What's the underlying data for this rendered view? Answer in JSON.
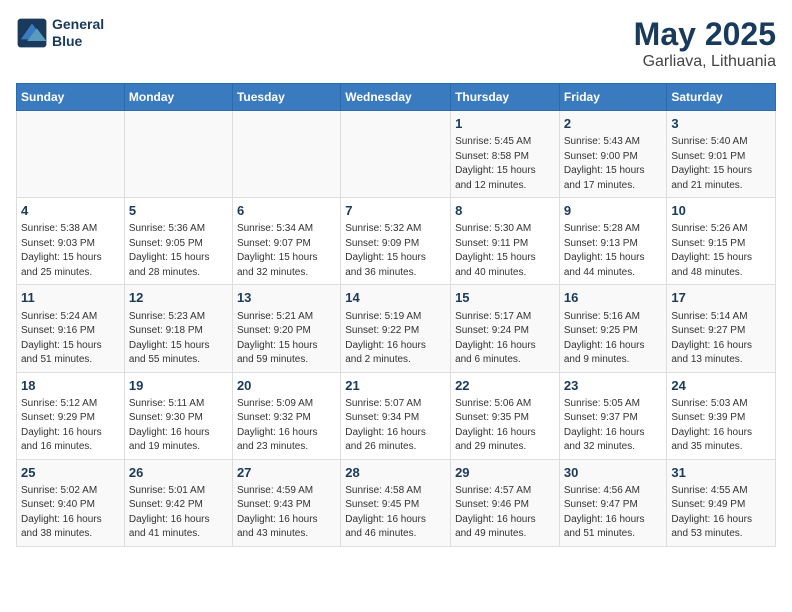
{
  "logo": {
    "text_line1": "General",
    "text_line2": "Blue"
  },
  "title": "May 2025",
  "subtitle": "Garliava, Lithuania",
  "headers": [
    "Sunday",
    "Monday",
    "Tuesday",
    "Wednesday",
    "Thursday",
    "Friday",
    "Saturday"
  ],
  "weeks": [
    [
      {
        "day": "",
        "info": ""
      },
      {
        "day": "",
        "info": ""
      },
      {
        "day": "",
        "info": ""
      },
      {
        "day": "",
        "info": ""
      },
      {
        "day": "1",
        "info": "Sunrise: 5:45 AM\nSunset: 8:58 PM\nDaylight: 15 hours\nand 12 minutes."
      },
      {
        "day": "2",
        "info": "Sunrise: 5:43 AM\nSunset: 9:00 PM\nDaylight: 15 hours\nand 17 minutes."
      },
      {
        "day": "3",
        "info": "Sunrise: 5:40 AM\nSunset: 9:01 PM\nDaylight: 15 hours\nand 21 minutes."
      }
    ],
    [
      {
        "day": "4",
        "info": "Sunrise: 5:38 AM\nSunset: 9:03 PM\nDaylight: 15 hours\nand 25 minutes."
      },
      {
        "day": "5",
        "info": "Sunrise: 5:36 AM\nSunset: 9:05 PM\nDaylight: 15 hours\nand 28 minutes."
      },
      {
        "day": "6",
        "info": "Sunrise: 5:34 AM\nSunset: 9:07 PM\nDaylight: 15 hours\nand 32 minutes."
      },
      {
        "day": "7",
        "info": "Sunrise: 5:32 AM\nSunset: 9:09 PM\nDaylight: 15 hours\nand 36 minutes."
      },
      {
        "day": "8",
        "info": "Sunrise: 5:30 AM\nSunset: 9:11 PM\nDaylight: 15 hours\nand 40 minutes."
      },
      {
        "day": "9",
        "info": "Sunrise: 5:28 AM\nSunset: 9:13 PM\nDaylight: 15 hours\nand 44 minutes."
      },
      {
        "day": "10",
        "info": "Sunrise: 5:26 AM\nSunset: 9:15 PM\nDaylight: 15 hours\nand 48 minutes."
      }
    ],
    [
      {
        "day": "11",
        "info": "Sunrise: 5:24 AM\nSunset: 9:16 PM\nDaylight: 15 hours\nand 51 minutes."
      },
      {
        "day": "12",
        "info": "Sunrise: 5:23 AM\nSunset: 9:18 PM\nDaylight: 15 hours\nand 55 minutes."
      },
      {
        "day": "13",
        "info": "Sunrise: 5:21 AM\nSunset: 9:20 PM\nDaylight: 15 hours\nand 59 minutes."
      },
      {
        "day": "14",
        "info": "Sunrise: 5:19 AM\nSunset: 9:22 PM\nDaylight: 16 hours\nand 2 minutes."
      },
      {
        "day": "15",
        "info": "Sunrise: 5:17 AM\nSunset: 9:24 PM\nDaylight: 16 hours\nand 6 minutes."
      },
      {
        "day": "16",
        "info": "Sunrise: 5:16 AM\nSunset: 9:25 PM\nDaylight: 16 hours\nand 9 minutes."
      },
      {
        "day": "17",
        "info": "Sunrise: 5:14 AM\nSunset: 9:27 PM\nDaylight: 16 hours\nand 13 minutes."
      }
    ],
    [
      {
        "day": "18",
        "info": "Sunrise: 5:12 AM\nSunset: 9:29 PM\nDaylight: 16 hours\nand 16 minutes."
      },
      {
        "day": "19",
        "info": "Sunrise: 5:11 AM\nSunset: 9:30 PM\nDaylight: 16 hours\nand 19 minutes."
      },
      {
        "day": "20",
        "info": "Sunrise: 5:09 AM\nSunset: 9:32 PM\nDaylight: 16 hours\nand 23 minutes."
      },
      {
        "day": "21",
        "info": "Sunrise: 5:07 AM\nSunset: 9:34 PM\nDaylight: 16 hours\nand 26 minutes."
      },
      {
        "day": "22",
        "info": "Sunrise: 5:06 AM\nSunset: 9:35 PM\nDaylight: 16 hours\nand 29 minutes."
      },
      {
        "day": "23",
        "info": "Sunrise: 5:05 AM\nSunset: 9:37 PM\nDaylight: 16 hours\nand 32 minutes."
      },
      {
        "day": "24",
        "info": "Sunrise: 5:03 AM\nSunset: 9:39 PM\nDaylight: 16 hours\nand 35 minutes."
      }
    ],
    [
      {
        "day": "25",
        "info": "Sunrise: 5:02 AM\nSunset: 9:40 PM\nDaylight: 16 hours\nand 38 minutes."
      },
      {
        "day": "26",
        "info": "Sunrise: 5:01 AM\nSunset: 9:42 PM\nDaylight: 16 hours\nand 41 minutes."
      },
      {
        "day": "27",
        "info": "Sunrise: 4:59 AM\nSunset: 9:43 PM\nDaylight: 16 hours\nand 43 minutes."
      },
      {
        "day": "28",
        "info": "Sunrise: 4:58 AM\nSunset: 9:45 PM\nDaylight: 16 hours\nand 46 minutes."
      },
      {
        "day": "29",
        "info": "Sunrise: 4:57 AM\nSunset: 9:46 PM\nDaylight: 16 hours\nand 49 minutes."
      },
      {
        "day": "30",
        "info": "Sunrise: 4:56 AM\nSunset: 9:47 PM\nDaylight: 16 hours\nand 51 minutes."
      },
      {
        "day": "31",
        "info": "Sunrise: 4:55 AM\nSunset: 9:49 PM\nDaylight: 16 hours\nand 53 minutes."
      }
    ]
  ]
}
